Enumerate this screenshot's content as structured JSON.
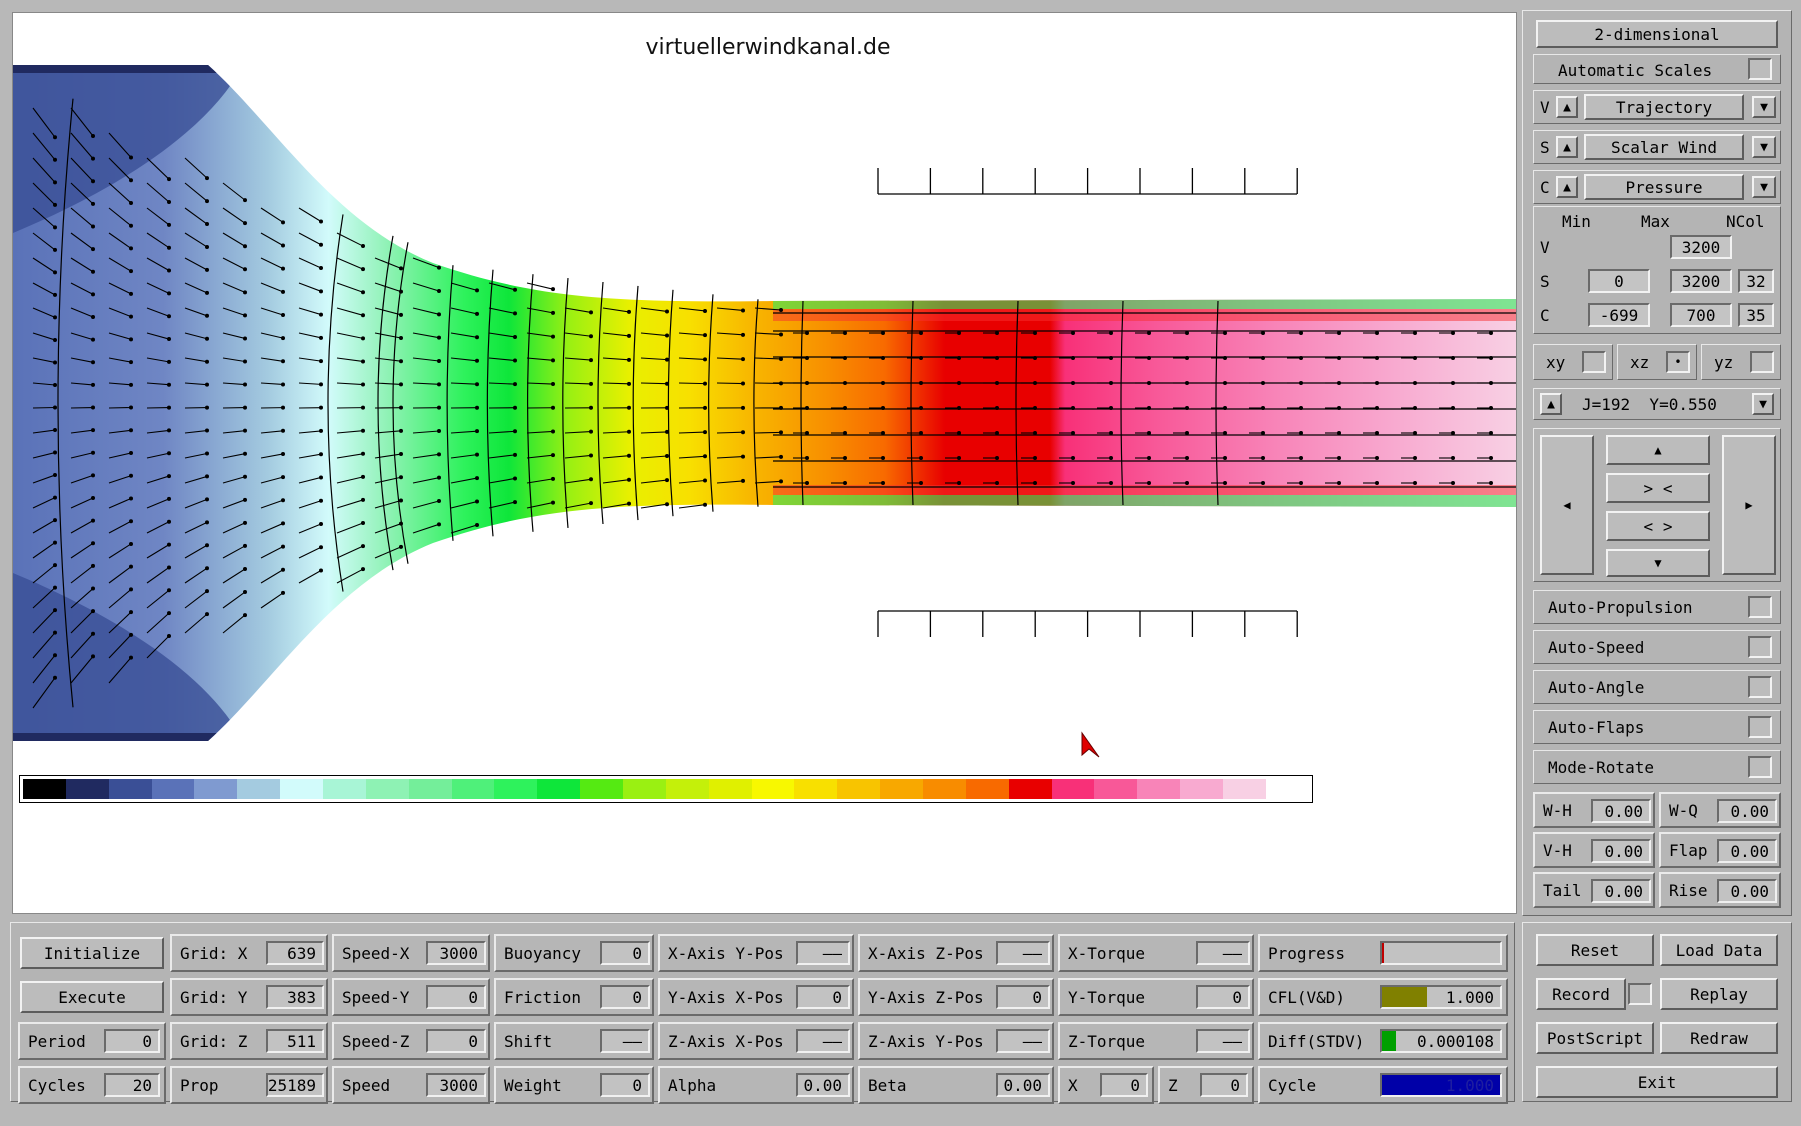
{
  "site_title": "virtuellerwindkanal.de",
  "colorbar": [
    "#000000",
    "#202a60",
    "#3a4f96",
    "#5a72b8",
    "#7f9ad0",
    "#a4cbe0",
    "#d2fbfb",
    "#a8f5d6",
    "#8ef2b4",
    "#74ee9a",
    "#4ff07a",
    "#2ef25c",
    "#0ee63a",
    "#55ea12",
    "#9af012",
    "#c4f00a",
    "#e0f000",
    "#f8f800",
    "#f8e000",
    "#f8c400",
    "#f8a800",
    "#f88c00",
    "#f86a00",
    "#e80000",
    "#f83078",
    "#f85898",
    "#f884b8",
    "#f8aad0",
    "#f8d0e4",
    "#ffffff"
  ],
  "right": {
    "mode_button": "2-dimensional",
    "auto_scales": "Automatic Scales",
    "rows": [
      {
        "tag": "V",
        "label": "Trajectory"
      },
      {
        "tag": "S",
        "label": "Scalar Wind"
      },
      {
        "tag": "C",
        "label": "Pressure"
      }
    ],
    "scale_headers": {
      "min": "Min",
      "max": "Max",
      "ncol": "NCol"
    },
    "scales": [
      {
        "tag": "V",
        "min": "",
        "max": "3200",
        "ncol": ""
      },
      {
        "tag": "S",
        "min": "0",
        "max": "3200",
        "ncol": "32"
      },
      {
        "tag": "C",
        "min": "-699",
        "max": "700",
        "ncol": "35"
      }
    ],
    "planes": [
      "xy",
      "xz",
      "yz"
    ],
    "slice_label": "J=192  Y=0.550",
    "nav": {
      "up": "▲",
      "zoom_in": "> <",
      "zoom_out": "< >",
      "down": "▼",
      "left": "◀",
      "right": "▶"
    },
    "toggles": [
      "Auto-Propulsion",
      "Auto-Speed",
      "Auto-Angle",
      "Auto-Flaps",
      "Mode-Rotate"
    ],
    "angles": [
      {
        "label": "W-H",
        "value": "0.00"
      },
      {
        "label": "W-Q",
        "value": "0.00"
      },
      {
        "label": "V-H",
        "value": "0.00"
      },
      {
        "label": "Flap",
        "value": "0.00"
      },
      {
        "label": "Tail",
        "value": "0.00"
      },
      {
        "label": "Rise",
        "value": "0.00"
      }
    ]
  },
  "bottom": {
    "col1": [
      "Initialize",
      "Execute"
    ],
    "period": {
      "label": "Period",
      "value": "0"
    },
    "cycles": {
      "label": "Cycles",
      "value": "20"
    },
    "grid": [
      {
        "label": "Grid: X",
        "value": "639"
      },
      {
        "label": "Grid: Y",
        "value": "383"
      },
      {
        "label": "Grid: Z",
        "value": "511"
      },
      {
        "label": "Prop",
        "value": "25189"
      }
    ],
    "speed": [
      {
        "label": "Speed-X",
        "value": "3000"
      },
      {
        "label": "Speed-Y",
        "value": "0"
      },
      {
        "label": "Speed-Z",
        "value": "0"
      },
      {
        "label": "Speed",
        "value": "3000"
      }
    ],
    "forces": [
      {
        "label": "Buoyancy",
        "value": "0"
      },
      {
        "label": "Friction",
        "value": "0"
      },
      {
        "label": "Shift",
        "value": "——"
      },
      {
        "label": "Weight",
        "value": "0"
      }
    ],
    "axes1": [
      {
        "label": "X-Axis Y-Pos",
        "value": "——"
      },
      {
        "label": "Y-Axis X-Pos",
        "value": "0"
      },
      {
        "label": "Z-Axis X-Pos",
        "value": "——"
      },
      {
        "label": "Alpha",
        "value": "0.00"
      }
    ],
    "axes2": [
      {
        "label": "X-Axis Z-Pos",
        "value": "——"
      },
      {
        "label": "Y-Axis Z-Pos",
        "value": "0"
      },
      {
        "label": "Z-Axis Y-Pos",
        "value": "——"
      },
      {
        "label": "Beta",
        "value": "0.00"
      }
    ],
    "torques": [
      {
        "label": "X-Torque",
        "value": "——"
      },
      {
        "label": "Y-Torque",
        "value": "0"
      },
      {
        "label": "Z-Torque",
        "value": "——"
      }
    ],
    "xz": [
      {
        "label": "X",
        "value": "0"
      },
      {
        "label": "Z",
        "value": "0"
      }
    ],
    "status": [
      {
        "label": "Progress",
        "value": ""
      },
      {
        "label": "CFL(V&D)",
        "value": "1.000"
      },
      {
        "label": "Diff(STDV)",
        "value": "0.000108"
      },
      {
        "label": "Cycle",
        "value": "1.000"
      }
    ],
    "progress_fraction": 0.0,
    "status_colors": {
      "cfl": "#808000",
      "diff_marker": "#00a000",
      "cycle": "#0000a8"
    },
    "actions": [
      "Reset",
      "Load Data",
      "Record",
      "Replay",
      "PostScript",
      "Redraw",
      "Exit"
    ]
  }
}
